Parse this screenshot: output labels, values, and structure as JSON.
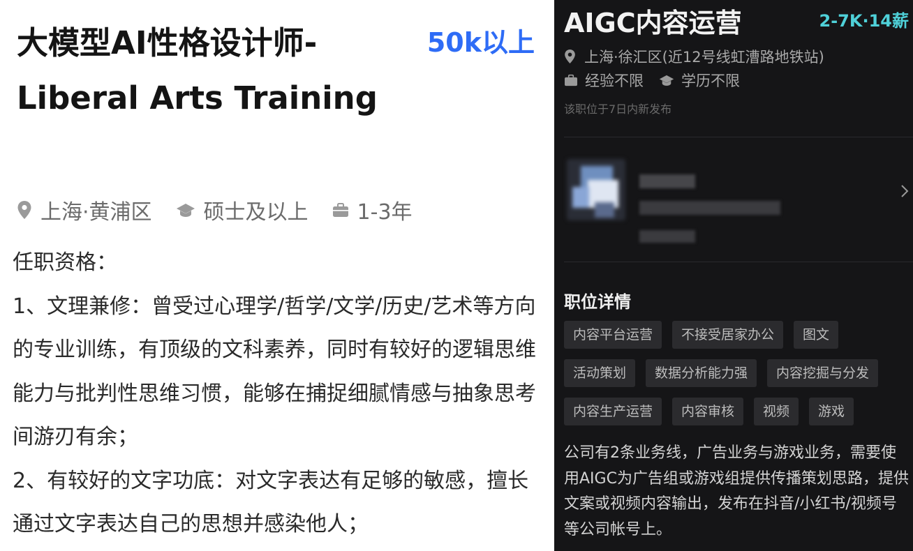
{
  "left_job": {
    "title": "大模型AI性格设计师-Liberal Arts Training",
    "salary": "50k以上",
    "location": "上海·黄浦区",
    "education": "硕士及以上",
    "experience": "1-3年",
    "requirements_heading": "任职资格：",
    "requirement_1": "1、文理兼修：曾受过心理学/哲学/文学/历史/艺术等方向的专业训练，有顶级的文科素养，同时有较好的逻辑思维能力与批判性思维习惯，能够在捕捉细腻情感与抽象思考间游刃有余；",
    "requirement_2": "2、有较好的文字功底：对文字表达有足够的敏感，擅长通过文字表达自己的思想并感染他人；",
    "icons": [
      "location-pin-icon",
      "graduation-cap-icon",
      "briefcase-icon"
    ],
    "colors": {
      "salary": "#2e6cf6",
      "meta": "#6b6b6b"
    }
  },
  "right_job": {
    "title": "AIGC内容运营",
    "salary": "2-7K·14薪",
    "location": "上海·徐汇区(近12号线虹漕路地铁站)",
    "experience": "经验不限",
    "education": "学历不限",
    "posted": "该职位于7日内新发布",
    "section_title": "职位详情",
    "tags": [
      [
        "内容平台运营",
        "不接受居家办公",
        "图文"
      ],
      [
        "活动策划",
        "数据分析能力强",
        "内容挖掘与分发"
      ],
      [
        "内容生产运营",
        "内容审核",
        "视频",
        "游戏"
      ]
    ],
    "description": "公司有2条业务线，广告业务与游戏业务，需要使用AIGC为广告组或游戏组提供传播策划思路，提供文案或视频内容输出，发布在抖音/小红书/视频号等公司帐号上。",
    "icons": [
      "location-pin-icon",
      "briefcase-icon",
      "graduation-cap-icon",
      "chevron-right-icon"
    ],
    "colors": {
      "background": "#151517",
      "salary": "#4fd1d9",
      "tag_bg": "#2b2b2e"
    }
  }
}
